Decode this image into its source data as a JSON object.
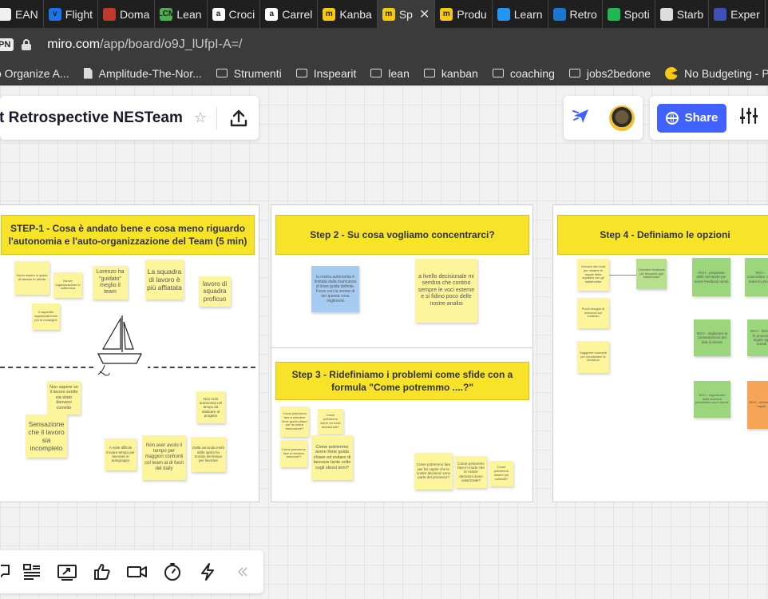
{
  "browser": {
    "tabs": [
      {
        "label": "EAN",
        "fav_color": "#f0f0f0",
        "fav_char": ""
      },
      {
        "label": "Flight",
        "fav_color": "#1a73e8",
        "fav_char": "v"
      },
      {
        "label": "Doma",
        "fav_color": "#c0392b",
        "fav_char": ""
      },
      {
        "label": "Lean",
        "fav_color": "#4caf50",
        "fav_char": "LCM"
      },
      {
        "label": "Croci",
        "fav_color": "#ffffff",
        "fav_char": "a"
      },
      {
        "label": "Carrel",
        "fav_color": "#ffffff",
        "fav_char": "a"
      },
      {
        "label": "Kanba",
        "fav_color": "#f6c915",
        "fav_char": "m"
      },
      {
        "label": "Sp",
        "fav_color": "#f6c915",
        "fav_char": "m",
        "active": true
      },
      {
        "label": "Produ",
        "fav_color": "#f6c915",
        "fav_char": "m"
      },
      {
        "label": "Learn",
        "fav_color": "#2196f3",
        "fav_char": ""
      },
      {
        "label": "Retro",
        "fav_color": "#1976d2",
        "fav_char": ""
      },
      {
        "label": "Spoti",
        "fav_color": "#1db954",
        "fav_char": ""
      },
      {
        "label": "Starb",
        "fav_color": "#dddddd",
        "fav_char": ""
      },
      {
        "label": "Exper",
        "fav_color": "#3f51b5",
        "fav_char": ""
      }
    ],
    "new_tab": "+",
    "close_tab": "✕",
    "vpn_badge": "PN",
    "url_host": "miro.com",
    "url_path": "/app/board/o9J_lUfpI-A=/",
    "bookmarks": [
      {
        "label": "o Organize A...",
        "type": "none"
      },
      {
        "label": "Amplitude-The-Nor...",
        "type": "doc"
      },
      {
        "label": "Strumenti",
        "type": "folder"
      },
      {
        "label": "Inspearit",
        "type": "folder"
      },
      {
        "label": "lean",
        "type": "folder"
      },
      {
        "label": "kanban",
        "type": "folder"
      },
      {
        "label": "coaching",
        "type": "folder"
      },
      {
        "label": "jobs2bedone",
        "type": "folder"
      },
      {
        "label": "No Budgeting - Per...",
        "type": "pac"
      }
    ]
  },
  "board": {
    "title": "t Retrospective NESTeam",
    "star": "☆",
    "share_label": "Share"
  },
  "frames": {
    "step1": {
      "header": "STEP-1 - Cosa è andato bene e cosa meno riguardo l'autonomia e l'auto-organizzazione del Team (5 min)",
      "notes": [
        "Vorrei essere in grado di stimare le attività",
        "Nuove organizzazione in sofferenza",
        "Lorenzo ha \"guidato\" meglio il team",
        "La squadra di lavoro è più affiatata",
        "lavoro di squadra proficuo",
        "Il vaporetto organizzati bene per le consegne",
        "Non sapere se il lavoro svolto sia stato davvero corretto",
        "Sensazione che il lavoro sia incompleto",
        "A volte difficile trovare tempo per lavorare in autogruppo",
        "Non aver avuto il tempo per maggiori confronti col team al di fuori del daily",
        "Dalla seconda metà della sprint ho trovato del tempo per lavorare",
        "Non ciclo autonomia nel tempo da dedicare al progetto"
      ]
    },
    "step2": {
      "header": "Step 2 - Su cosa vogliamo concentrarci?",
      "notes": [
        "la nostra autonomia è limitata dalla mancanza di linee guida definite. Forse con la review di ieri questa cosa migliorerà",
        "a livello decisionale mi sembra che contino sempre le voci esterne e si fidino poco delle nostre analisi"
      ]
    },
    "step3": {
      "header": "Step 3 - Ridefiniamo i problemi come sfide con a formula \"Come potremmo ....?\"",
      "notes": [
        "Come potremmo fare a chiedere linee guida chiare per la vostra esecuzione?",
        "Come potremmo avere un ruolo decisionale?",
        "Come potremmo fare a renderci autonomi?",
        "Come potremmo avere linne guida chiare ed evitare di lavorare tante volte sugli stessi temi?",
        "Come potremmo fare per far capire che le nostre decisioni sono parte del processo?",
        "Come potremmo fare in modo che le nostre decisioni siano valorizzate?",
        "Come potremmo essere più coinvolti?"
      ]
    },
    "step4": {
      "header": "Step 4 - Definiamo le opzioni",
      "notes": [
        "Cercare dei modi per chiarire le regole della squadra con gli stakeholder",
        "Chiedere feedback più frequenti agli stakeholder",
        "Priorità chiare fin dall'inizio dello sprint",
        "Suggerire momenti per condividere le decisioni",
        "Pochi margini di manovra sul contesto",
        "NCH - preparare delle domande per avere feedback mirati",
        "NCH - concordare con il team le priorità",
        "NCH - migliorare la presentazione dei dati al cliente",
        "NCH - limitare le proposte legate agli ambiti",
        "NCH - organizzare delle sessioni periodiche con il cliente",
        "NCH - rivedere le regole"
      ]
    }
  },
  "colors": {
    "sticky_yellow": "#fdf59b",
    "header_yellow": "#f7e32a",
    "sticky_blue": "#a7ccf2",
    "sticky_green": "#b8e08a",
    "sticky_orange": "#f6a455",
    "share_blue": "#4262ff"
  },
  "toolbar": {
    "icons": [
      "comment-icon",
      "list-icon",
      "share-screen-icon",
      "thumbs-up-icon",
      "video-icon",
      "timer-icon",
      "bolt-icon",
      "collapse-icon"
    ]
  }
}
